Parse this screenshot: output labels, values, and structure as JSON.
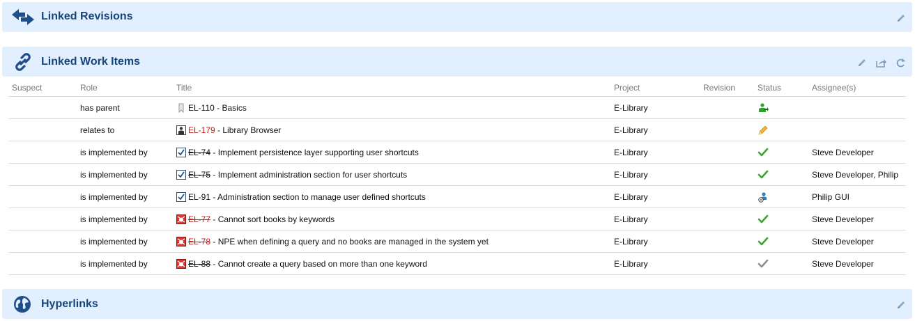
{
  "sections": {
    "linked_revisions": {
      "title": "Linked Revisions"
    },
    "linked_work_items": {
      "title": "Linked Work Items"
    },
    "hyperlinks": {
      "title": "Hyperlinks"
    }
  },
  "table": {
    "headers": {
      "suspect": "Suspect",
      "role": "Role",
      "title": "Title",
      "project": "Project",
      "revision": "Revision",
      "status": "Status",
      "assignees": "Assignee(s)"
    },
    "rows": [
      {
        "suspect": "",
        "role": "has parent",
        "type_icon": "bookmark-icon",
        "id": "EL-110",
        "id_style": "normal",
        "title": "- Basics",
        "project": "E-Library",
        "revision": "",
        "status_icon": "user-arrow-icon",
        "assignees": ""
      },
      {
        "suspect": "",
        "role": "relates to",
        "type_icon": "user-story-icon",
        "id": "EL-179",
        "id_style": "red",
        "title": "- Library Browser",
        "project": "E-Library",
        "revision": "",
        "status_icon": "pencil-icon",
        "assignees": ""
      },
      {
        "suspect": "",
        "role": "is implemented by",
        "type_icon": "task-icon",
        "id": "EL-74",
        "id_style": "strike",
        "title": "- Implement persistence layer supporting user shortcuts",
        "project": "E-Library",
        "revision": "",
        "status_icon": "check-icon",
        "assignees": "Steve Developer"
      },
      {
        "suspect": "",
        "role": "is implemented by",
        "type_icon": "task-icon",
        "id": "EL-75",
        "id_style": "strike",
        "title": "- Implement administration section for user shortcuts",
        "project": "E-Library",
        "revision": "",
        "status_icon": "check-icon",
        "assignees": "Steve Developer, Philip"
      },
      {
        "suspect": "",
        "role": "is implemented by",
        "type_icon": "task-icon",
        "id": "EL-91",
        "id_style": "normal",
        "title": "- Administration section to manage user defined shortcuts",
        "project": "E-Library",
        "revision": "",
        "status_icon": "user-gear-icon",
        "assignees": "Philip GUI"
      },
      {
        "suspect": "",
        "role": "is implemented by",
        "type_icon": "defect-icon",
        "id": "EL-77",
        "id_style": "red-strike",
        "title": "- Cannot sort books by keywords",
        "project": "E-Library",
        "revision": "",
        "status_icon": "check-icon",
        "assignees": "Steve Developer"
      },
      {
        "suspect": "",
        "role": "is implemented by",
        "type_icon": "defect-icon",
        "id": "EL-78",
        "id_style": "red-strike",
        "title": "- NPE when defining a query and no books are managed in the system yet",
        "project": "E-Library",
        "revision": "",
        "status_icon": "check-icon",
        "assignees": "Steve Developer"
      },
      {
        "suspect": "",
        "role": "is implemented by",
        "type_icon": "defect-icon",
        "id": "EL-88",
        "id_style": "strike",
        "title": "- Cannot create a query based on more than one keyword",
        "project": "E-Library",
        "revision": "",
        "status_icon": "check-gray-icon",
        "assignees": "Steve Developer"
      }
    ]
  },
  "colors": {
    "panel_bg": "#e1efff",
    "section_title": "#17457a",
    "link_red": "#c41c1c",
    "status_green": "#3aa52d"
  }
}
